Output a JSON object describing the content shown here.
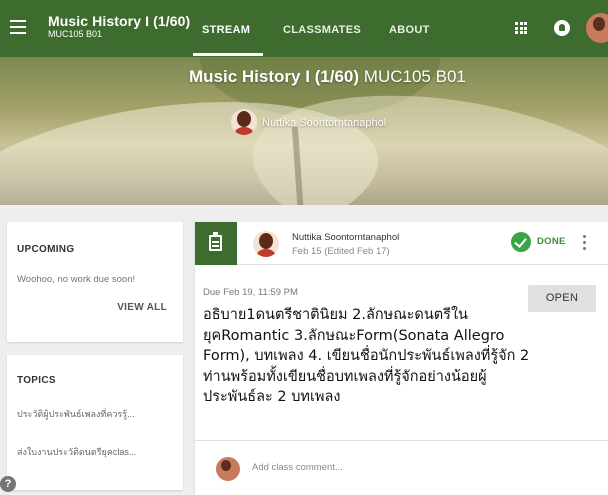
{
  "header": {
    "course_title": "Music History I (1/60)",
    "course_code": "MUC105 B01",
    "tabs": [
      {
        "label": "STREAM",
        "active": true
      },
      {
        "label": "CLASSMATES",
        "active": false
      },
      {
        "label": "ABOUT",
        "active": false
      }
    ],
    "icons": [
      "menu-icon",
      "apps-icon",
      "notifications-icon",
      "account-avatar"
    ]
  },
  "banner": {
    "title_main": "Music History I (1/60)",
    "title_code": "MUC105 B01",
    "teacher_name": "Nuttika Soontorntanaphol"
  },
  "sidebar": {
    "upcoming": {
      "heading": "UPCOMING",
      "message": "Woohoo, no work due soon!",
      "view_all": "VIEW ALL"
    },
    "topics": {
      "heading": "TOPICS",
      "items": [
        "ประวัติผู้ประพันธ์เพลงที่ควรรู้...",
        "ส่งใบงานประวัติดนตรียุคclas..."
      ]
    }
  },
  "assignment": {
    "poster": "Nuttika Soontorntanaphol",
    "posted": "Feb 15 (Edited Feb 17)",
    "status": "DONE",
    "due": "Due Feb 19, 11:59 PM",
    "open_label": "OPEN",
    "body": "อธิบาย1ดนตรีชาตินิยม 2.ลักษณะดนตรีในยุคRomantic 3.ลักษณะForm(Sonata Allegro Form), บทเพลง 4. เขียนชื่อนักประพันธ์เพลงที่รู้จัก 2 ท่านพร้อมทั้งเขียนชื่อบทเพลงที่รู้จักอย่างน้อยผู้ประพันธ์ละ 2 บทเพลง",
    "comment_placeholder": "Add class comment..."
  },
  "colors": {
    "header_green": "#3e6b2e",
    "done_green": "#3ea44a"
  }
}
